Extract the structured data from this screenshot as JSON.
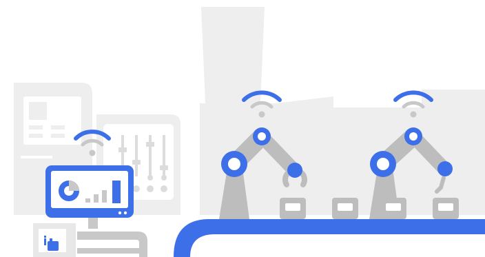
{
  "colors": {
    "background": "#ffffff",
    "factory_silhouette": "#eeeeef",
    "panel_gray": "#e6e6e6",
    "detail_gray": "#c8c8c8",
    "robot_gray": "#bdbdbd",
    "accent_blue": "#3d6fe8",
    "white": "#ffffff"
  },
  "icons": {
    "wifi": "wifi-icon",
    "donut": "donut-chart-icon",
    "bars": "bar-chart-icon",
    "hand": "hand-pointer-icon",
    "robot": "robotic-arm-icon",
    "box": "package-box-icon"
  },
  "dashboard": {
    "bar_levels": [
      0.2,
      0.4,
      0.6,
      0.95
    ]
  }
}
